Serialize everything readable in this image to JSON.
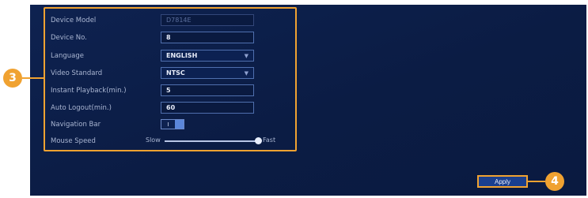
{
  "settings": {
    "device_model": {
      "label": "Device Model",
      "value": "D7814E"
    },
    "device_no": {
      "label": "Device No.",
      "value": "8"
    },
    "language": {
      "label": "Language",
      "value": "ENGLISH"
    },
    "video_standard": {
      "label": "Video Standard",
      "value": "NTSC"
    },
    "instant_playback": {
      "label": "Instant Playback(min.)",
      "value": "5"
    },
    "auto_logout": {
      "label": "Auto Logout(min.)",
      "value": "60"
    },
    "navigation_bar": {
      "label": "Navigation Bar",
      "toggle_text": "I"
    },
    "mouse_speed": {
      "label": "Mouse Speed",
      "slow_label": "Slow",
      "fast_label": "Fast",
      "level": 1.0
    }
  },
  "apply_label": "Apply",
  "callouts": {
    "settings": "3",
    "apply": "4"
  },
  "colors": {
    "accent": "#f0a231",
    "background": "#0b1c44",
    "button": "#1a3f8f"
  },
  "icons": {
    "dropdown": "chevron-down-icon"
  }
}
